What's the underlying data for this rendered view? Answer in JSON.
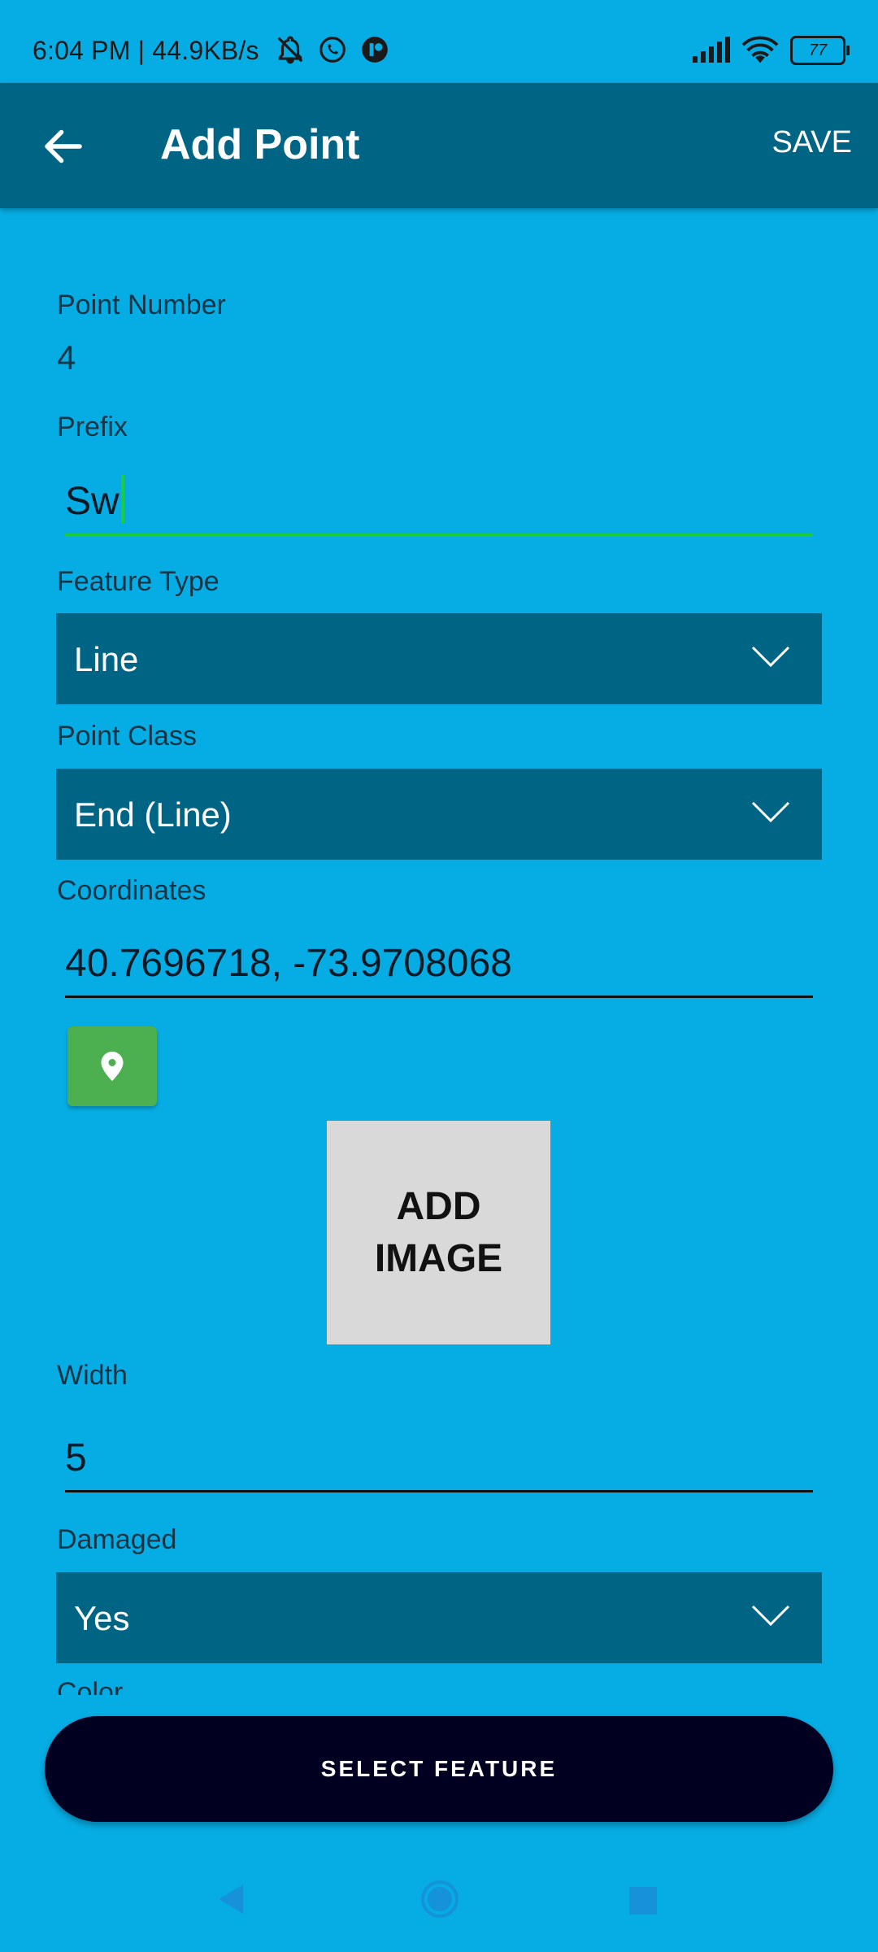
{
  "status_bar": {
    "time_speed": "6:04 PM | 44.9KB/s",
    "battery": "77",
    "icons": [
      "bell-off-icon",
      "whatsapp-icon",
      "app-icon",
      "signal-icon",
      "wifi-icon",
      "battery-icon"
    ]
  },
  "app_bar": {
    "title": "Add Point",
    "save_label": "SAVE",
    "back_icon": "arrow-left-icon"
  },
  "form": {
    "point_number_label": "Point Number",
    "point_number_value": "4",
    "prefix_label": "Prefix",
    "prefix_value": "Sw",
    "feature_type_label": "Feature Type",
    "feature_type_value": "Line",
    "point_class_label": "Point Class",
    "point_class_value": "End (Line)",
    "coordinates_label": "Coordinates",
    "coordinates_value": "40.7696718, -73.9708068",
    "location_icon": "map-pin-icon",
    "add_image_label": "ADD\nIMAGE",
    "width_label": "Width",
    "width_value": "5",
    "damaged_label": "Damaged",
    "damaged_value": "Yes",
    "next_label_partial": "Color"
  },
  "actions": {
    "select_feature_label": "SELECT FEATURE"
  },
  "colors": {
    "background": "#06ade4",
    "app_bar": "#006584",
    "dropdown": "#006584",
    "active_underline": "#1dcc3c",
    "location_button": "#4caf50",
    "primary_button": "#020020"
  }
}
